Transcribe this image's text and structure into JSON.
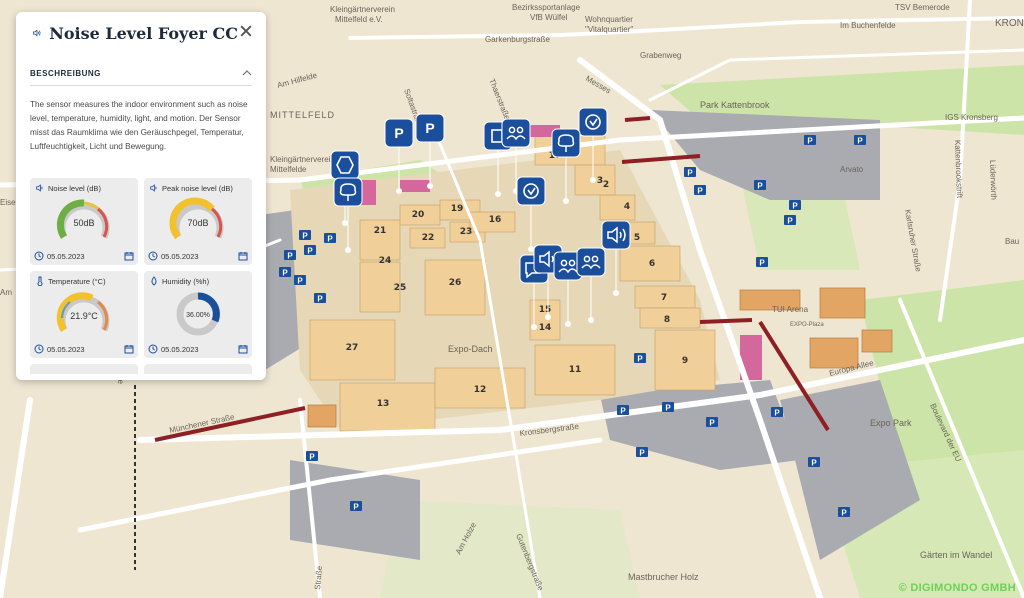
{
  "panel": {
    "title": "Noise Level Foyer CC",
    "section_label": "BESCHREIBUNG",
    "description": "The sensor measures the indoor environment such as noise level, temperature, humidity, light, and motion. Der Sensor misst das Raumklima wie den Geräuschpegel, Temperatur, Luftfeuchtigkeit, Licht und Bewegung.",
    "cards": [
      {
        "title": "Noise level (dB)",
        "value": "50dB",
        "date": "05.05.2023",
        "level": 0.5
      },
      {
        "title": "Peak noise level (dB)",
        "value": "70dB",
        "date": "05.05.2023",
        "level": 0.7
      },
      {
        "title": "Temperature (°C)",
        "value": "21.9°C",
        "date": "05.05.2023",
        "level": 0.55
      },
      {
        "title": "Humidity (%h)",
        "value": "36.00%",
        "date": "05.05.2023",
        "level": 0.36
      }
    ]
  },
  "map": {
    "streets": [
      "Garkenburgstraße",
      "Am Hilfelde",
      "Thaerstraße",
      "Messes",
      "Grabenweg",
      "Im Buchenfelde",
      "Kattenbrookstrift",
      "Lüderwörth",
      "Karlsruher Straße",
      "Münchener Straße",
      "Kronsbergstraße",
      "Boulevard der EU",
      "Am Holze",
      "Gutenbergstraße",
      "Straße",
      "Expo-Plaza",
      "Europa Allee"
    ],
    "places": [
      "MITTELFELD",
      "Kleingärtnerverein Mittelfeld e.V.",
      "Bezirkssportanlage VfB Wülfel",
      "Wohnquartier \"Vitalquartier\"",
      "TSV Bemerode",
      "KRON",
      "Park Kattenbrook",
      "IGS Kronsberg",
      "Arvato",
      "Expo-Dach",
      "Expo Park",
      "Gärten im Wandel",
      "Mastbrucher Holz",
      "TUI Arena",
      "Bau",
      "Kleingärtnerverein Mittelfelde",
      "Eise",
      "Am"
    ],
    "halls": [
      "2",
      "3",
      "4",
      "5",
      "6",
      "7",
      "8",
      "9",
      "11",
      "12",
      "13",
      "14",
      "15",
      "16",
      "17",
      "19",
      "20",
      "21",
      "22",
      "23",
      "24",
      "25",
      "26",
      "27"
    ]
  },
  "copyright": "© DIGIMONDO GMBH",
  "colors": {
    "pin": "#1b4f9c",
    "panel_bg": "#ffffff",
    "hall": "#f1cf98",
    "green": "#c9e0a4",
    "parking": "#a4a6ab",
    "accent_line": "#8e1f24",
    "pink": "#d4679b",
    "orange": "#e2a564"
  }
}
